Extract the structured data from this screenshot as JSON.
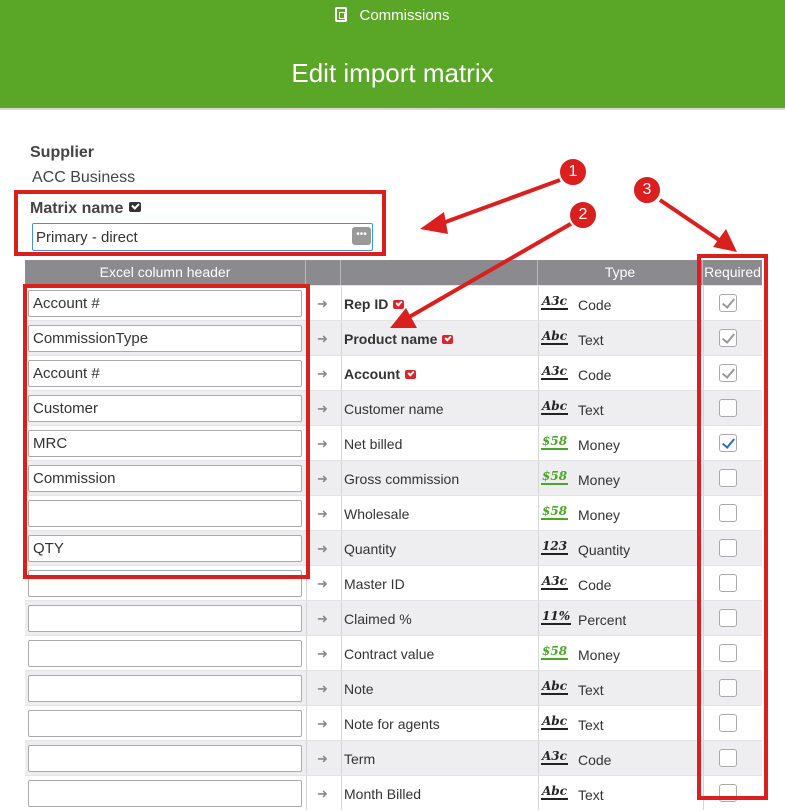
{
  "header": {
    "app_name": "Commissions",
    "title": "Edit import matrix"
  },
  "form": {
    "supplier_label": "Supplier",
    "supplier_value": "ACC Business",
    "matrix_label": "Matrix name",
    "matrix_value": "Primary - direct",
    "dots_label": "•••"
  },
  "table": {
    "headers": {
      "excel": "Excel column header",
      "type": "Type",
      "required": "Required"
    },
    "rows": [
      {
        "excel": "Account #",
        "field": "Rep ID",
        "field_required": true,
        "type_icon": "A3c",
        "type": "Code",
        "required": "checked-disabled"
      },
      {
        "excel": "CommissionType",
        "field": "Product name",
        "field_required": true,
        "type_icon": "Abc",
        "type": "Text",
        "required": "checked-disabled"
      },
      {
        "excel": "Account #",
        "field": "Account",
        "field_required": true,
        "type_icon": "A3c",
        "type": "Code",
        "required": "checked-disabled"
      },
      {
        "excel": "Customer",
        "field": "Customer name",
        "field_required": false,
        "type_icon": "Abc",
        "type": "Text",
        "required": "unchecked"
      },
      {
        "excel": "MRC",
        "field": "Net billed",
        "field_required": false,
        "type_icon": "$58",
        "type": "Money",
        "required": "checked"
      },
      {
        "excel": "Commission",
        "field": "Gross commission",
        "field_required": false,
        "type_icon": "$58",
        "type": "Money",
        "required": "unchecked"
      },
      {
        "excel": "",
        "field": "Wholesale",
        "field_required": false,
        "type_icon": "$58",
        "type": "Money",
        "required": "unchecked"
      },
      {
        "excel": "QTY",
        "field": "Quantity",
        "field_required": false,
        "type_icon": "123",
        "type": "Quantity",
        "required": "unchecked"
      },
      {
        "excel": "",
        "field": "Master ID",
        "field_required": false,
        "type_icon": "A3c",
        "type": "Code",
        "required": "unchecked"
      },
      {
        "excel": "",
        "field": "Claimed %",
        "field_required": false,
        "type_icon": "11%",
        "type": "Percent",
        "required": "unchecked"
      },
      {
        "excel": "",
        "field": "Contract value",
        "field_required": false,
        "type_icon": "$58",
        "type": "Money",
        "required": "unchecked"
      },
      {
        "excel": "",
        "field": "Note",
        "field_required": false,
        "type_icon": "Abc",
        "type": "Text",
        "required": "unchecked"
      },
      {
        "excel": "",
        "field": "Note for agents",
        "field_required": false,
        "type_icon": "Abc",
        "type": "Text",
        "required": "unchecked"
      },
      {
        "excel": "",
        "field": "Term",
        "field_required": false,
        "type_icon": "A3c",
        "type": "Code",
        "required": "unchecked"
      },
      {
        "excel": "",
        "field": "Month Billed",
        "field_required": false,
        "type_icon": "Abc",
        "type": "Text",
        "required": "unchecked"
      }
    ]
  },
  "annotations": {
    "callout_1": "1",
    "callout_2": "2",
    "callout_3": "3",
    "color": "#d9201f"
  },
  "colors": {
    "header_bg": "#5aa728",
    "table_header_bg": "#8a8a8f",
    "money_icon": "#4aa52a",
    "focus_border": "#4a90d9"
  }
}
